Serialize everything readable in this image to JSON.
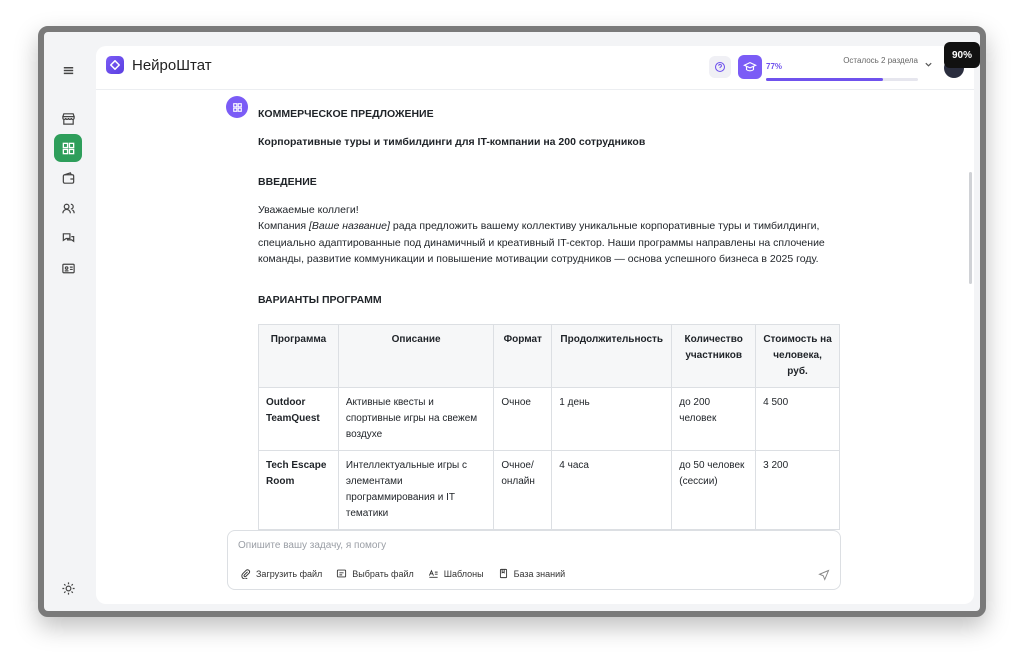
{
  "app": {
    "name": "НейроШтат",
    "zoom": "90%"
  },
  "header": {
    "progress_pct": "77%",
    "progress_value": 0.77,
    "remaining": "Осталось 2 раздела"
  },
  "sidebar": {
    "icons": [
      "menu-icon",
      "store-icon",
      "grid-icon",
      "wallet-icon",
      "users-icon",
      "chat-icon",
      "id-card-icon",
      "sun-icon"
    ]
  },
  "document": {
    "title": "КОММЕРЧЕСКОЕ ПРЕДЛОЖЕНИЕ",
    "subtitle": "Корпоративные туры и тимбилдинги для IT-компании на 200 сотрудников",
    "intro_heading": "ВВЕДЕНИЕ",
    "greeting": "Уважаемые коллеги!",
    "intro_prefix": "Компания ",
    "intro_placeholder": "[Ваше название]",
    "intro_body": " рада предложить вашему коллективу уникальные корпоративные туры и тимбилдинги, специально адаптированные под динамичный и креативный IT-сектор. Наши программы направлены на сплочение команды, развитие коммуникации и повышение мотивации сотрудников — основа успешного бизнеса в 2025 году.",
    "programs_heading": "ВАРИАНТЫ ПРОГРАММ"
  },
  "table": {
    "headers": [
      "Программа",
      "Описание",
      "Формат",
      "Продолжительность",
      "Количество участников",
      "Стоимость на человека, руб."
    ],
    "rows": [
      [
        "Outdoor TeamQuest",
        "Активные квесты и спортивные игры на свежем воздухе",
        "Очное",
        "1 день",
        "до 200 человек",
        "4 500"
      ],
      [
        "Tech Escape Room",
        "Интеллектуальные игры с элементами программирования и IT тематики",
        "Очное/ онлайн",
        "4 часа",
        "до 50 человек (сессии)",
        "3 200"
      ]
    ]
  },
  "composer": {
    "placeholder": "Опишите вашу задачу, я помогу",
    "upload": "Загрузить файл",
    "choose": "Выбрать файл",
    "templates": "Шаблоны",
    "knowledge": "База знаний"
  }
}
